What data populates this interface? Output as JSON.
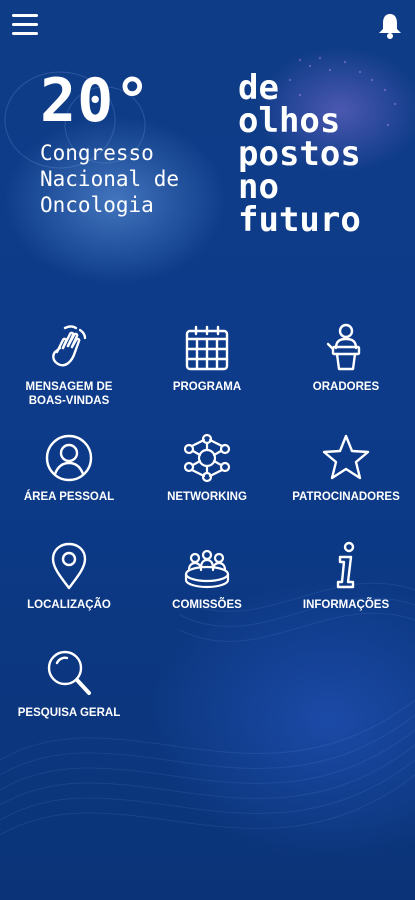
{
  "hero": {
    "number": "20°",
    "subtitle_lines": [
      "Congresso",
      "Nacional de",
      "Oncologia"
    ],
    "tagline_lines": [
      "de",
      "olhos",
      "postos",
      "no",
      "futuro"
    ]
  },
  "menu": {
    "items": [
      {
        "label_lines": [
          "MENSAGEM DE",
          "BOAS-VINDAS"
        ],
        "icon": "waving-hand-icon"
      },
      {
        "label_lines": [
          "PROGRAMA"
        ],
        "icon": "calendar-icon"
      },
      {
        "label_lines": [
          "ORADORES"
        ],
        "icon": "speaker-podium-icon"
      },
      {
        "label_lines": [
          "ÁREA PESSOAL"
        ],
        "icon": "user-circle-icon"
      },
      {
        "label_lines": [
          "NETWORKING"
        ],
        "icon": "network-icon"
      },
      {
        "label_lines": [
          "PATROCINADORES"
        ],
        "icon": "star-icon"
      },
      {
        "label_lines": [
          "LOCALIZAÇÃO"
        ],
        "icon": "location-pin-icon"
      },
      {
        "label_lines": [
          "COMISSÕES"
        ],
        "icon": "committee-icon"
      },
      {
        "label_lines": [
          "INFORMAÇÕES"
        ],
        "icon": "info-icon"
      },
      {
        "label_lines": [
          "PESQUISA GERAL"
        ],
        "icon": "search-icon"
      }
    ]
  },
  "colors": {
    "background": "#0d3b8a",
    "foreground": "#ffffff"
  }
}
